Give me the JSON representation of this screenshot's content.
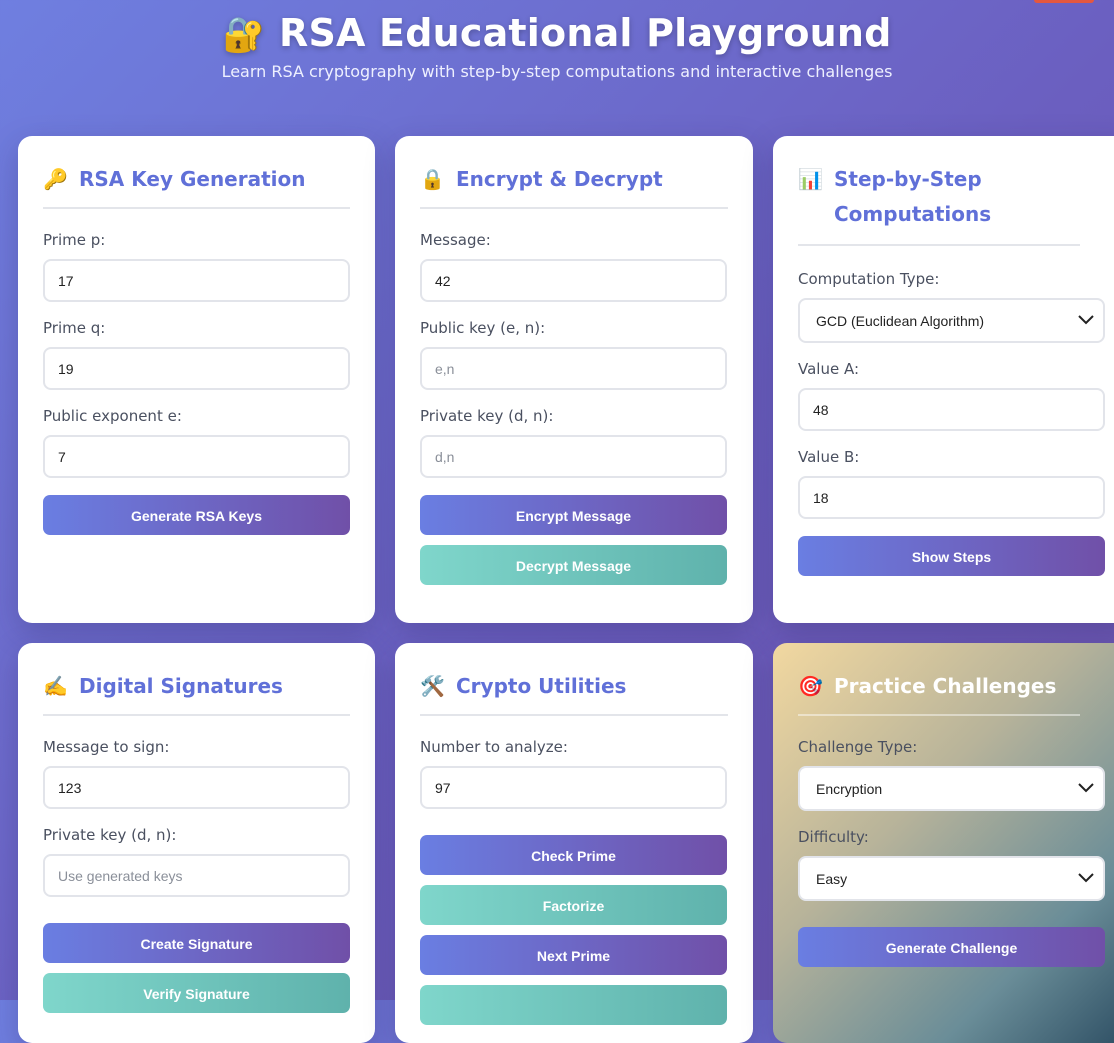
{
  "header": {
    "title": "RSA Educational Playground",
    "title_icon": "lock-with-key-icon",
    "subtitle": "Learn RSA cryptography with step-by-step computations and interactive challenges"
  },
  "key_generation": {
    "title": "RSA Key Generation",
    "icon": "key-icon",
    "prime_p_label": "Prime p:",
    "prime_p_value": "17",
    "prime_q_label": "Prime q:",
    "prime_q_value": "19",
    "exponent_label": "Public exponent e:",
    "exponent_value": "7",
    "generate_button": "Generate RSA Keys"
  },
  "encrypt_decrypt": {
    "title": "Encrypt & Decrypt",
    "icon": "lock-icon",
    "message_label": "Message:",
    "message_value": "42",
    "public_key_label": "Public key (e, n):",
    "public_key_placeholder": "e,n",
    "private_key_label": "Private key (d, n):",
    "private_key_placeholder": "d,n",
    "encrypt_button": "Encrypt Message",
    "decrypt_button": "Decrypt Message"
  },
  "computations": {
    "title": "Step-by-Step Computations",
    "icon": "bar-chart-icon",
    "type_label": "Computation Type:",
    "type_selected": "GCD (Euclidean Algorithm)",
    "value_a_label": "Value A:",
    "value_a": "48",
    "value_b_label": "Value B:",
    "value_b": "18",
    "steps_button": "Show Steps"
  },
  "signatures": {
    "title": "Digital Signatures",
    "icon": "writing-hand-icon",
    "message_label": "Message to sign:",
    "message_value": "123",
    "private_key_label": "Private key (d, n):",
    "private_key_placeholder": "Use generated keys",
    "create_button": "Create Signature",
    "verify_button": "Verify Signature"
  },
  "utilities": {
    "title": "Crypto Utilities",
    "icon": "tools-icon",
    "number_label": "Number to analyze:",
    "number_value": "97",
    "check_prime_button": "Check Prime",
    "factorize_button": "Factorize",
    "next_prime_button": "Next Prime"
  },
  "challenges": {
    "title": "Practice Challenges",
    "icon": "target-icon",
    "type_label": "Challenge Type:",
    "type_selected": "Encryption",
    "difficulty_label": "Difficulty:",
    "difficulty_selected": "Easy",
    "generate_button": "Generate Challenge"
  }
}
